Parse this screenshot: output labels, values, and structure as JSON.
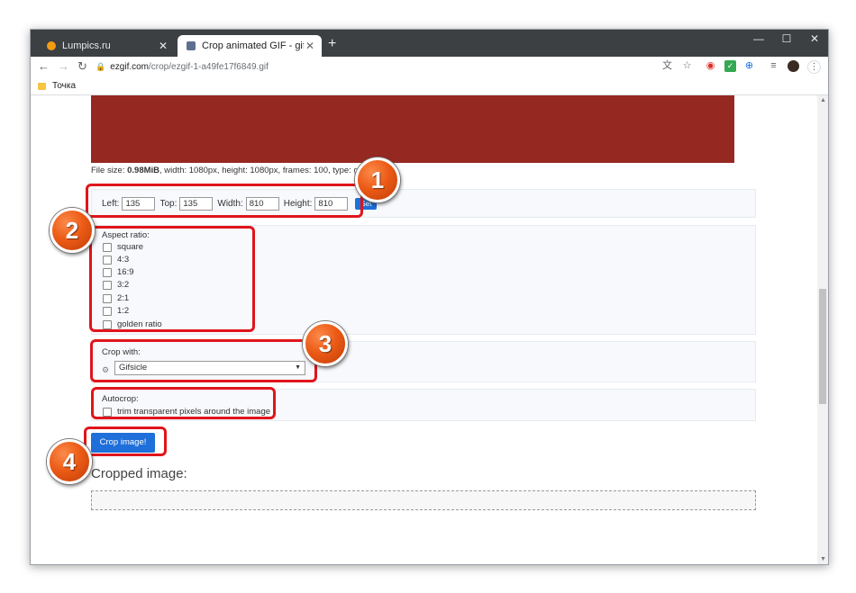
{
  "browser": {
    "tabs": [
      {
        "title": "Lumpics.ru",
        "favicon_color": "#f39c12"
      },
      {
        "title": "Crop animated GIF - gif-man-me",
        "favicon_color": "#5f6f8f"
      }
    ],
    "new_tab": "+",
    "window_controls": {
      "minimize": "—",
      "maximize": "☐",
      "close": "✕"
    },
    "url_host": "ezgif.com",
    "url_path": "/crop/ezgif-1-a49fe17f6849.gif",
    "bookmarks": [
      {
        "label": "Точка"
      }
    ]
  },
  "page": {
    "file_info": {
      "prefix": "File size: ",
      "size": "0.98MiB",
      "details": ", width: 1080px, height: 1080px, frames: 100, type: gif"
    },
    "coords": {
      "left_label": "Left:",
      "left_value": "135",
      "top_label": "Top:",
      "top_value": "135",
      "width_label": "Width:",
      "width_value": "810",
      "height_label": "Height:",
      "height_value": "810",
      "set_label": "Set"
    },
    "aspect": {
      "title": "Aspect ratio:",
      "options": [
        "square",
        "4:3",
        "16:9",
        "3:2",
        "2:1",
        "1:2",
        "golden ratio"
      ]
    },
    "crop_with": {
      "title": "Crop with:",
      "selected": "Gifsicle"
    },
    "autocrop": {
      "title": "Autocrop:",
      "option": "trim transparent pixels around the image"
    },
    "crop_button": "Crop image!",
    "cropped_title": "Cropped image:"
  },
  "annotations": {
    "badges": [
      "1",
      "2",
      "3",
      "4"
    ],
    "color": "#e0151b"
  }
}
